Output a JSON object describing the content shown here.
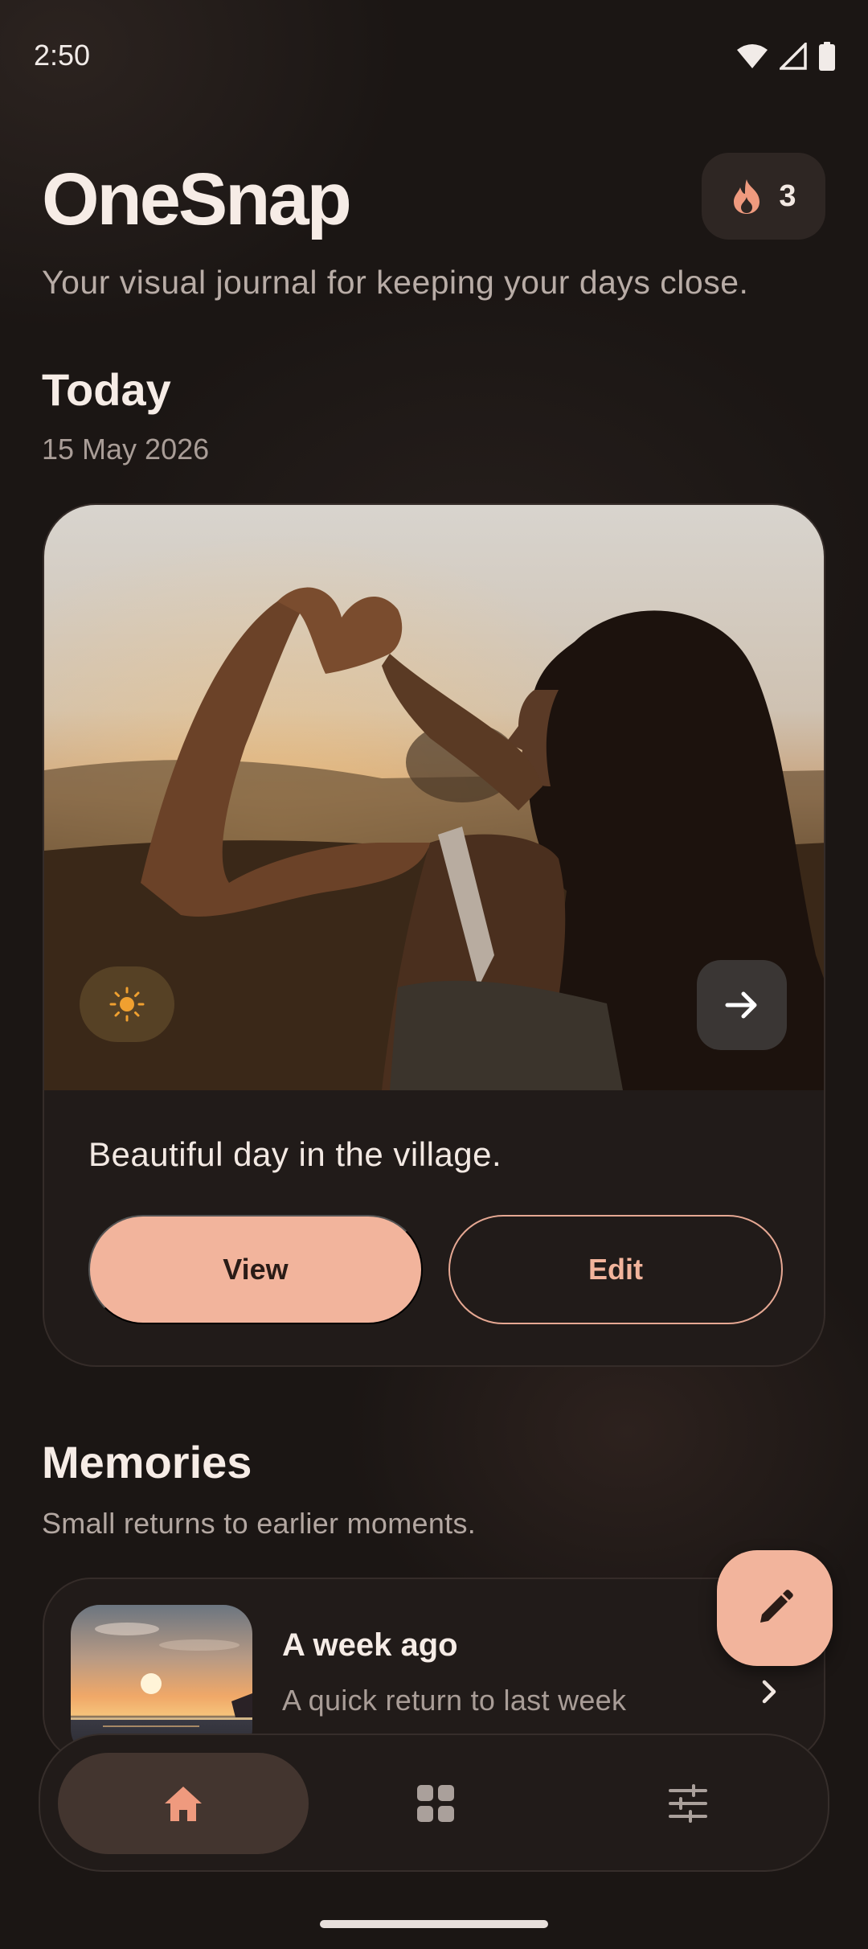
{
  "status_bar": {
    "time": "2:50"
  },
  "header": {
    "app_title": "OneSnap",
    "streak_count": "3",
    "subtitle": "Your visual journal for keeping your days close."
  },
  "today": {
    "heading": "Today",
    "date": "15 May 2026",
    "caption": "Beautiful day in the village.",
    "view_label": "View",
    "edit_label": "Edit",
    "weather_icon": "sun-icon"
  },
  "memories": {
    "heading": "Memories",
    "subtitle": "Small returns to earlier moments.",
    "items": [
      {
        "title": "A week ago",
        "description": "A quick return to last week"
      }
    ]
  },
  "nav": {
    "items": [
      {
        "icon": "home-icon",
        "active": true
      },
      {
        "icon": "gallery-icon",
        "active": false
      },
      {
        "icon": "settings-icon",
        "active": false
      }
    ]
  },
  "colors": {
    "background": "#1b1614",
    "card": "#211b19",
    "accent": "#f2b49c",
    "text_primary": "#f6ece6",
    "text_secondary": "#a99d97"
  }
}
